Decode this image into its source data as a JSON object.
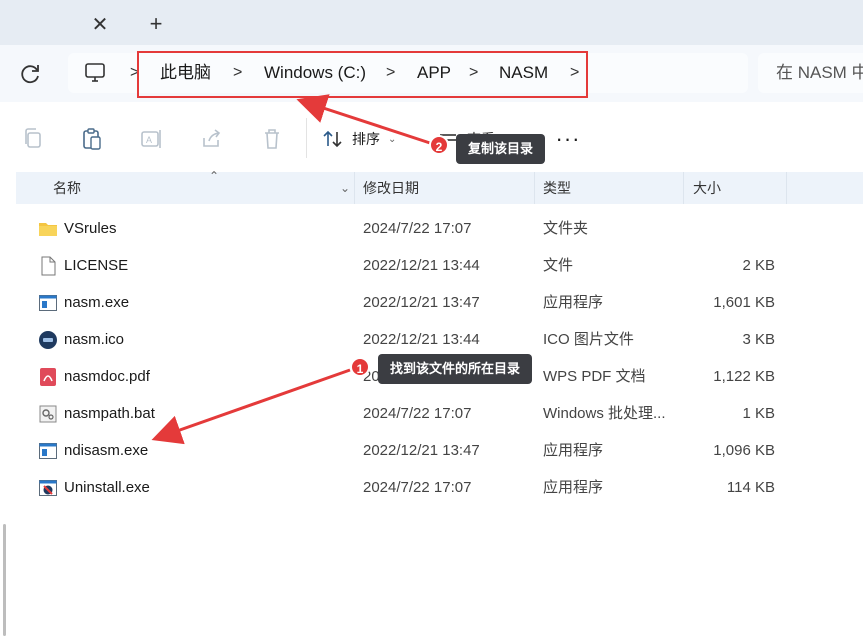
{
  "tabbar": {
    "close_glyph": "✕",
    "new_tab_glyph": "+"
  },
  "addressbar": {
    "crumbs": [
      "此电脑",
      "Windows (C:)",
      "APP",
      "NASM"
    ],
    "separator": ">",
    "search_placeholder": "在 NASM 中"
  },
  "toolbar": {
    "sort_label": "排序",
    "view_label": "查看",
    "more_label": "···"
  },
  "columns": {
    "name": "名称",
    "date": "修改日期",
    "type": "类型",
    "size": "大小"
  },
  "files": [
    {
      "name": "VSrules",
      "date": "2024/7/22 17:07",
      "type": "文件夹",
      "size": "",
      "icon": "folder-icon"
    },
    {
      "name": "LICENSE",
      "date": "2022/12/21 13:44",
      "type": "文件",
      "size": "2 KB",
      "icon": "file-icon"
    },
    {
      "name": "nasm.exe",
      "date": "2022/12/21 13:47",
      "type": "应用程序",
      "size": "1,601 KB",
      "icon": "exe-icon"
    },
    {
      "name": "nasm.ico",
      "date": "2022/12/21 13:44",
      "type": "ICO 图片文件",
      "size": "3 KB",
      "icon": "ico-icon"
    },
    {
      "name": "nasmdoc.pdf",
      "date": "2024/7/22 17:07",
      "type": "WPS PDF 文档",
      "size": "1,122 KB",
      "icon": "pdf-icon"
    },
    {
      "name": "nasmpath.bat",
      "date": "2024/7/22 17:07",
      "type": "Windows 批处理...",
      "size": "1 KB",
      "icon": "bat-icon"
    },
    {
      "name": "ndisasm.exe",
      "date": "2022/12/21 13:47",
      "type": "应用程序",
      "size": "1,096 KB",
      "icon": "exe-icon"
    },
    {
      "name": "Uninstall.exe",
      "date": "2024/7/22 17:07",
      "type": "应用程序",
      "size": "114 KB",
      "icon": "uninstall-icon"
    }
  ],
  "annotations": {
    "step1": {
      "badge": "1",
      "text": "找到该文件的所在目录"
    },
    "step2": {
      "badge": "2",
      "text": "复制该目录"
    }
  },
  "colors": {
    "accent_red": "#e43a3a",
    "callout_bg": "#3b3d42",
    "header_bg": "#edf3fa",
    "folder": "#f4c542"
  }
}
